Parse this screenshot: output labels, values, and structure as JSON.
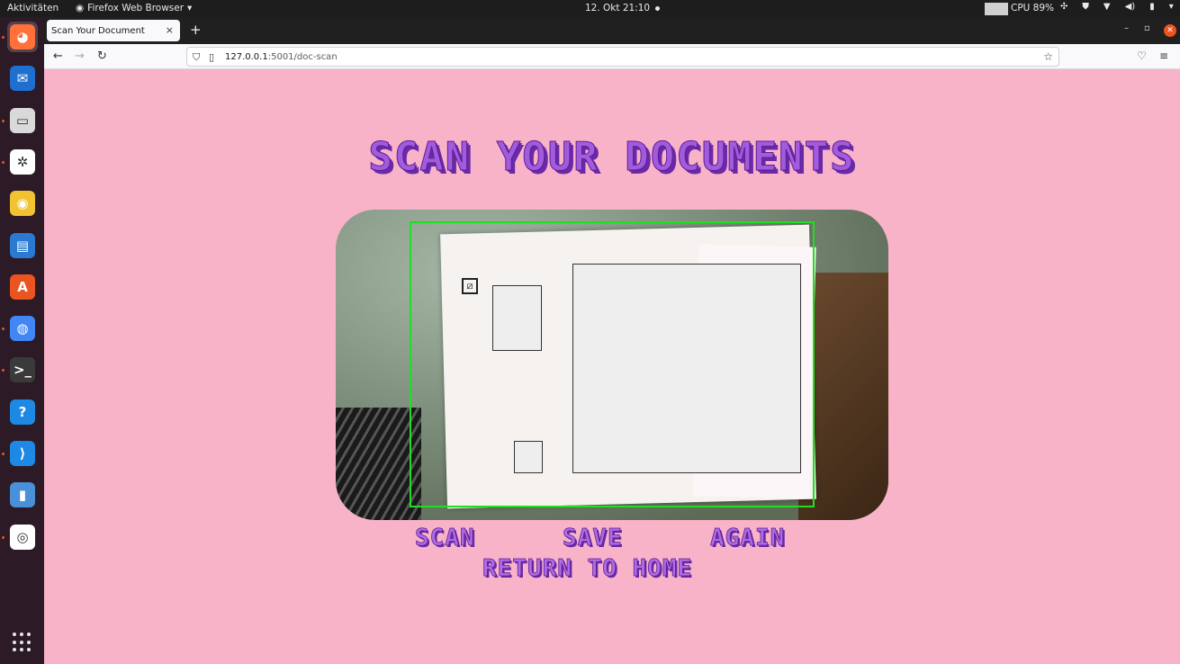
{
  "topbar": {
    "activities": "Aktivitäten",
    "app_menu": "Firefox Web Browser",
    "clock": "12. Okt  21:10",
    "cpu": "CPU 89%"
  },
  "dock": {
    "items": [
      {
        "name": "firefox-icon",
        "color": "#ff7139"
      },
      {
        "name": "thunderbird-icon",
        "color": "#1f6fd1"
      },
      {
        "name": "files-icon",
        "color": "#d9d9d9"
      },
      {
        "name": "slack-icon",
        "color": "#ffffff"
      },
      {
        "name": "rhythmbox-icon",
        "color": "#f1c232"
      },
      {
        "name": "libreoffice-writer-icon",
        "color": "#2a7ad2"
      },
      {
        "name": "software-center-icon",
        "color": "#e95420"
      },
      {
        "name": "chrome-icon",
        "color": "#4285f4"
      },
      {
        "name": "terminal-icon",
        "color": "#3a3a3a"
      },
      {
        "name": "help-icon",
        "color": "#1e88e5"
      },
      {
        "name": "vscode-icon",
        "color": "#1e88e5"
      },
      {
        "name": "ruler-icon",
        "color": "#4a90d9"
      },
      {
        "name": "webcam-icon",
        "color": "#ffffff"
      }
    ]
  },
  "browser": {
    "tab_title": "Scan Your Document",
    "url_host": "127.0.0.1",
    "url_path": ":5001/doc-scan"
  },
  "page": {
    "title": "Scan Your Documents",
    "actions": {
      "scan": "Scan",
      "save": "Save",
      "again": "Again",
      "home": "Return to Home"
    }
  }
}
